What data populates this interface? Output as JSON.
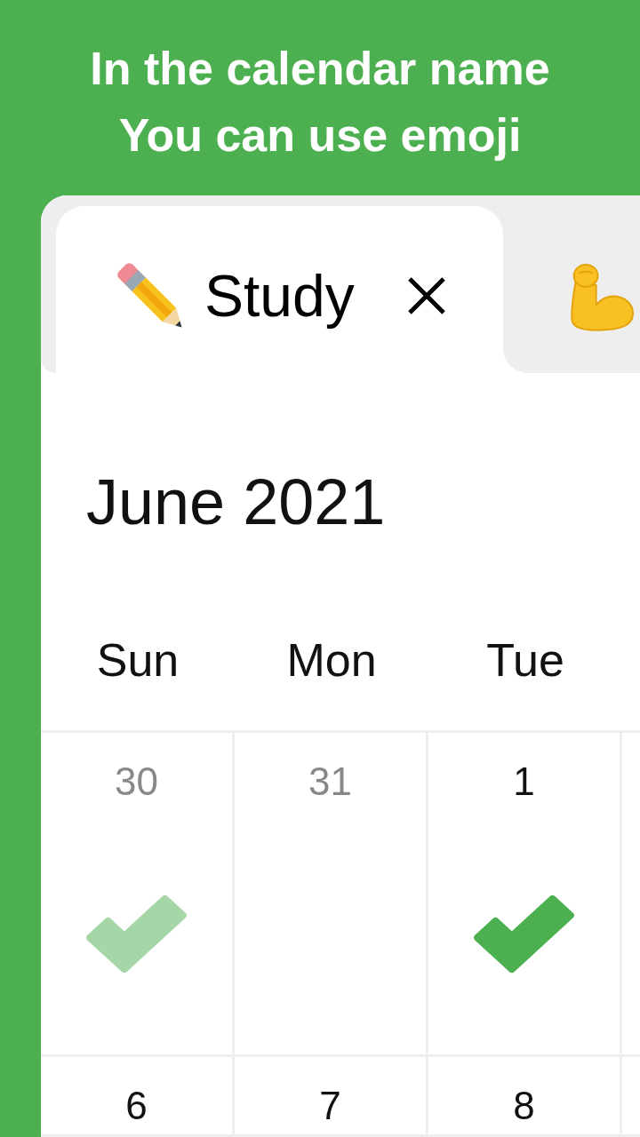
{
  "headline": "In the calendar name\nYou can use emoji",
  "tabs": [
    {
      "label": "Study",
      "selected": true
    },
    {
      "selected": false
    }
  ],
  "calendar": {
    "title": "June 2021",
    "weekdays": [
      "Sun",
      "Mon",
      "Tue"
    ],
    "weeks": [
      [
        {
          "day": "30",
          "in_month": false,
          "checked": true
        },
        {
          "day": "31",
          "in_month": false,
          "checked": false
        },
        {
          "day": "1",
          "in_month": true,
          "checked": true
        }
      ],
      [
        {
          "day": "6",
          "in_month": true
        },
        {
          "day": "7",
          "in_month": true
        },
        {
          "day": "8",
          "in_month": true
        }
      ]
    ]
  }
}
